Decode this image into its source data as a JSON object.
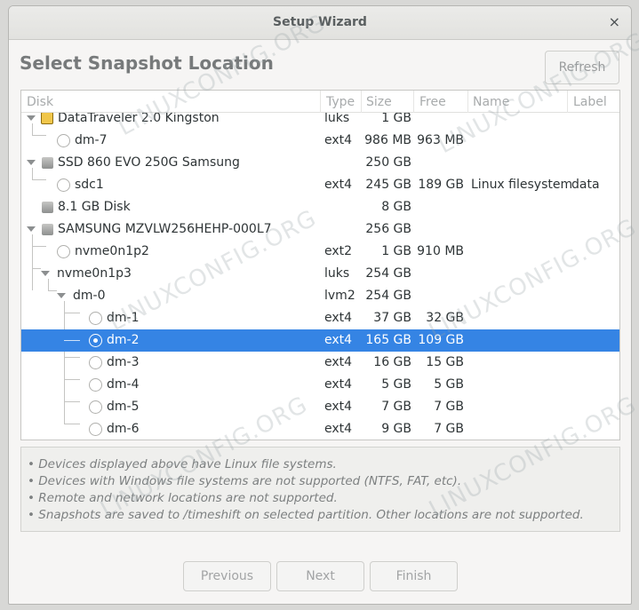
{
  "window": {
    "title": "Setup Wizard",
    "close_glyph": "×"
  },
  "page_title": "Select Snapshot Location",
  "refresh_label": "Refresh",
  "columns": [
    "Disk",
    "Type",
    "Size",
    "Free",
    "Name",
    "Label"
  ],
  "rows": [
    {
      "name": "DataTraveler 2.0 Kingston",
      "type": "luks",
      "size": "1 GB",
      "free": "",
      "fsname": "",
      "label": ""
    },
    {
      "name": "dm-7",
      "type": "ext4",
      "size": "986 MB",
      "free": "963 MB",
      "fsname": "",
      "label": ""
    },
    {
      "name": "SSD 860 EVO 250G Samsung",
      "type": "",
      "size": "250 GB",
      "free": "",
      "fsname": "",
      "label": ""
    },
    {
      "name": "sdc1",
      "type": "ext4",
      "size": "245 GB",
      "free": "189 GB",
      "fsname": "Linux filesystem",
      "label": "data"
    },
    {
      "name": "8.1 GB Disk",
      "type": "",
      "size": "8 GB",
      "free": "",
      "fsname": "",
      "label": ""
    },
    {
      "name": "SAMSUNG MZVLW256HEHP-000L7",
      "type": "",
      "size": "256 GB",
      "free": "",
      "fsname": "",
      "label": ""
    },
    {
      "name": "nvme0n1p2",
      "type": "ext2",
      "size": "1 GB",
      "free": "910 MB",
      "fsname": "",
      "label": ""
    },
    {
      "name": "nvme0n1p3",
      "type": "luks",
      "size": "254 GB",
      "free": "",
      "fsname": "",
      "label": ""
    },
    {
      "name": "dm-0",
      "type": "lvm2",
      "size": "254 GB",
      "free": "",
      "fsname": "",
      "label": ""
    },
    {
      "name": "dm-1",
      "type": "ext4",
      "size": "37 GB",
      "free": "32 GB",
      "fsname": "",
      "label": ""
    },
    {
      "name": "dm-2",
      "type": "ext4",
      "size": "165 GB",
      "free": "109 GB",
      "fsname": "",
      "label": ""
    },
    {
      "name": "dm-3",
      "type": "ext4",
      "size": "16 GB",
      "free": "15 GB",
      "fsname": "",
      "label": ""
    },
    {
      "name": "dm-4",
      "type": "ext4",
      "size": "5 GB",
      "free": "5 GB",
      "fsname": "",
      "label": ""
    },
    {
      "name": "dm-5",
      "type": "ext4",
      "size": "7 GB",
      "free": "7 GB",
      "fsname": "",
      "label": ""
    },
    {
      "name": "dm-6",
      "type": "ext4",
      "size": "9 GB",
      "free": "7 GB",
      "fsname": "",
      "label": ""
    }
  ],
  "info_lines": [
    "• Devices displayed above have Linux file systems.",
    "• Devices with Windows file systems are not supported (NTFS, FAT, etc).",
    "• Remote and network locations are not supported.",
    "• Snapshots are saved to /timeshift on selected partition. Other locations are not supported."
  ],
  "buttons": {
    "previous": "Previous",
    "next": "Next",
    "finish": "Finish"
  },
  "watermark_text": "LINUXCONFIG.ORG",
  "colors": {
    "selection": "#3584e4",
    "window_bg": "#f6f5f4"
  }
}
